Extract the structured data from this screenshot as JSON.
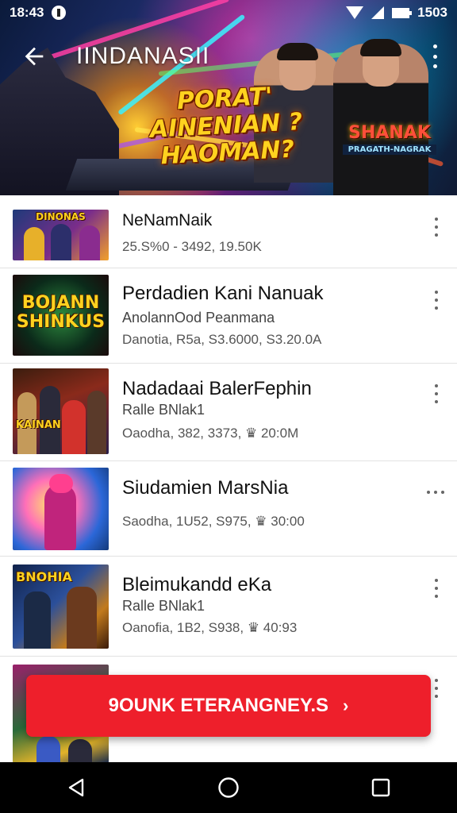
{
  "status_bar": {
    "time": "18:43",
    "battery": "1503"
  },
  "header": {
    "title": "IINDANASII",
    "banner_headline": "PORAT' AINENIAN ?HAOMAN?",
    "banner_logo_line1": "SHANAK",
    "banner_logo_line2": "PRAGATH-NAGRAK"
  },
  "items": [
    {
      "thumb_label": "DINONAS",
      "title": "NeNamNaik",
      "subtitle": "",
      "meta": "25.S%0 - 3492, 19.50K"
    },
    {
      "thumb_label": "BOJANN SHINKUS",
      "title": "Perdadien Kani Nanuak",
      "subtitle": "AnolannOod Peanmana",
      "meta": "Danotia, R5a, S3.6000, S3.20.0A"
    },
    {
      "thumb_label": "KAINAN",
      "title": "Nadadaai BalerFephin",
      "subtitle": "Ralle BNlak1",
      "meta": "Oaodha, 382, 3373, ♛ 20:0M"
    },
    {
      "thumb_label": "",
      "title": "Siudamien MarsNia",
      "subtitle": "",
      "meta": "Saodha, 1U52, S975, ♛ 30:00"
    },
    {
      "thumb_label": "BNOHIA",
      "title": "Bleimukandd eKa",
      "subtitle": "Ralle BNlak1",
      "meta": "Oanofia, 1B2, S938, ♛ 40:93"
    }
  ],
  "cta": {
    "label": "9OUNK ETERANGNEY.S",
    "chevron": "›"
  },
  "colors": {
    "cta": "#ee1f2b",
    "nav_bar": "#000000",
    "divider": "#e2e2e2"
  },
  "icons": {
    "back": "arrow-left-icon",
    "more": "more-vertical-icon",
    "nav_back": "triangle-back-icon",
    "nav_home": "circle-home-icon",
    "nav_recent": "square-recent-icon"
  }
}
